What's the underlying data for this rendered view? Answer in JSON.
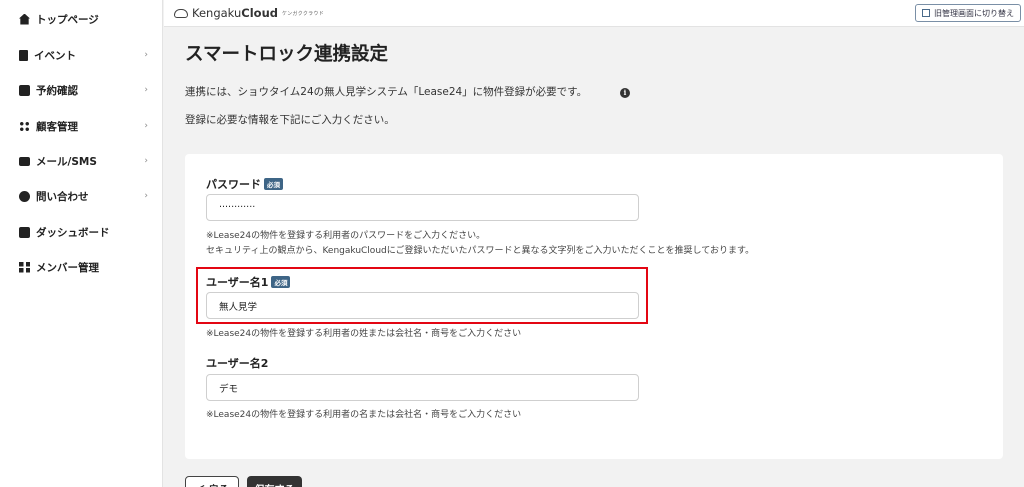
{
  "sidebar": {
    "items": [
      {
        "label": "トップページ",
        "icon": "home-icon",
        "chevron": ""
      },
      {
        "label": "イベント",
        "icon": "document-icon",
        "chevron": "›"
      },
      {
        "label": "予約確認",
        "icon": "calendar-icon",
        "chevron": "›"
      },
      {
        "label": "顧客管理",
        "icon": "users-icon",
        "chevron": "›"
      },
      {
        "label": "メール/SMS",
        "icon": "mail-icon",
        "chevron": "›"
      },
      {
        "label": "問い合わせ",
        "icon": "chat-icon",
        "chevron": "›"
      },
      {
        "label": "ダッシュボード",
        "icon": "chart-icon",
        "chevron": ""
      },
      {
        "label": "メンバー管理",
        "icon": "grid-icon",
        "chevron": ""
      }
    ]
  },
  "header": {
    "brand_light": "Kengaku",
    "brand_bold": "Cloud",
    "brand_kana": "ケンガククラウド",
    "old_admin_label": "旧管理画面に切り替え"
  },
  "main": {
    "title": "スマートロック連携設定",
    "description_1": "連携には、ショウタイム24の無人見学システム「Lease24」に物件登録が必要です。",
    "description_2": "登録に必要な情報を下記にご入力ください。",
    "info_icon_glyph": "i"
  },
  "form": {
    "required_badge": "必須",
    "password": {
      "label": "パスワード",
      "value": "············",
      "hint_1": "※Lease24の物件を登録する利用者のパスワードをご入力ください。",
      "hint_2": "セキュリティ上の観点から、KengakuCloudにご登録いただいたパスワードと異なる文字列をご入力いただくことを推奨しております。"
    },
    "username1": {
      "label": "ユーザー名1",
      "value": "無人見学",
      "hint": "※Lease24の物件を登録する利用者の姓または会社名・商号をご入力ください"
    },
    "username2": {
      "label": "ユーザー名2",
      "value": "デモ",
      "hint": "※Lease24の物件を登録する利用者の名または会社名・商号をご入力ください"
    }
  },
  "actions": {
    "back_label": "＜ 戻る",
    "save_label": "保存する"
  },
  "colors": {
    "highlight": "#e30613",
    "badge": "#3e6586",
    "save_button": "#333333"
  }
}
